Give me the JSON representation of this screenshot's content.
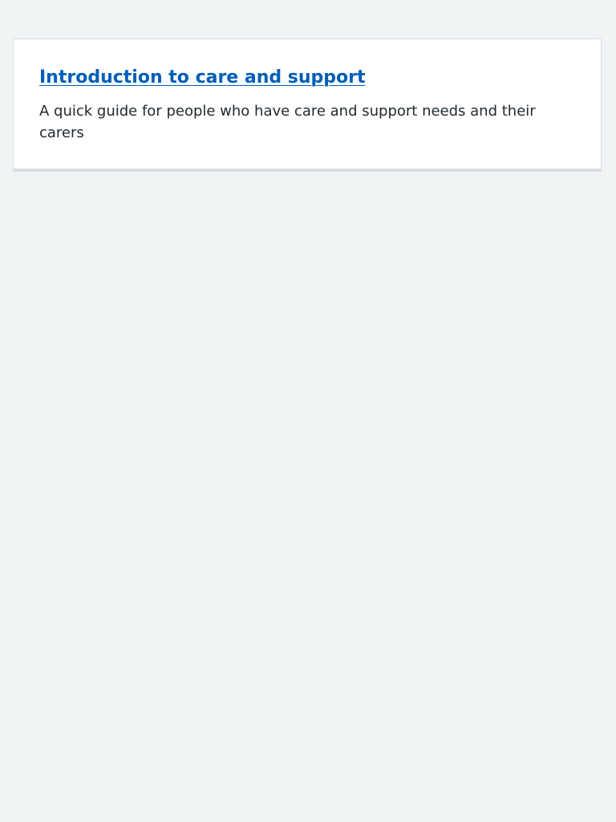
{
  "card": {
    "title": "Introduction to care and support",
    "description": "A quick guide for people who have care and support needs and their carers"
  },
  "colors": {
    "background": "#f0f4f5",
    "card_background": "#ffffff",
    "card_border": "#d8dde0",
    "link": "#005eb8",
    "text": "#212b32"
  }
}
